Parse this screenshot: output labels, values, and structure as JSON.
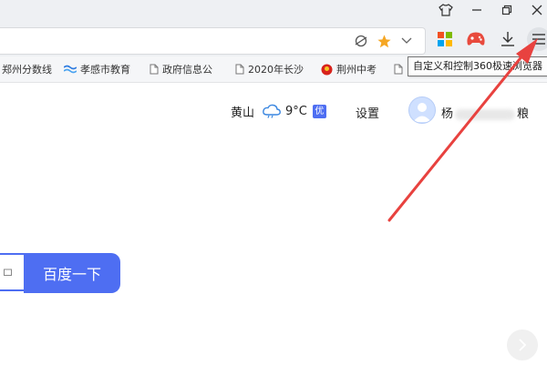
{
  "window_controls": {
    "skin_icon": "tshirt-icon",
    "minimize_icon": "minimize-icon",
    "maximize_icon": "restore-icon",
    "close_icon": "close-icon"
  },
  "address_bar": {
    "url_value": "",
    "reader_icon": "reader-mode-icon",
    "favorite_icon": "star-icon",
    "dropdown_icon": "chevron-down-icon"
  },
  "toolbar": {
    "apps_icon": "app-grid-icon",
    "game_icon": "gamepad-icon",
    "download_icon": "download-icon",
    "menu_icon": "hamburger-menu-icon"
  },
  "bookmarks": [
    {
      "label": "郑州分数线",
      "icon": "none"
    },
    {
      "label": "孝感市教育",
      "icon": "wave-icon"
    },
    {
      "label": "政府信息公",
      "icon": "document-icon"
    },
    {
      "label": "2020年长沙",
      "icon": "document-icon"
    },
    {
      "label": "荆州中考",
      "icon": "emblem-icon"
    },
    {
      "label": "",
      "icon": "document-icon"
    }
  ],
  "tooltip": {
    "text": "自定义和控制360极速浏览器"
  },
  "header": {
    "city": "黄山",
    "temperature": "9°C",
    "aqi_badge": "优",
    "settings_label": "设置",
    "user_name_prefix": "杨",
    "user_name_suffix": "粮"
  },
  "search": {
    "input_value": "",
    "button_label": "百度一下"
  },
  "colors": {
    "accent": "#4e6ef2",
    "annotation_arrow": "#e8423f",
    "chrome_bg": "#eef0f3"
  }
}
